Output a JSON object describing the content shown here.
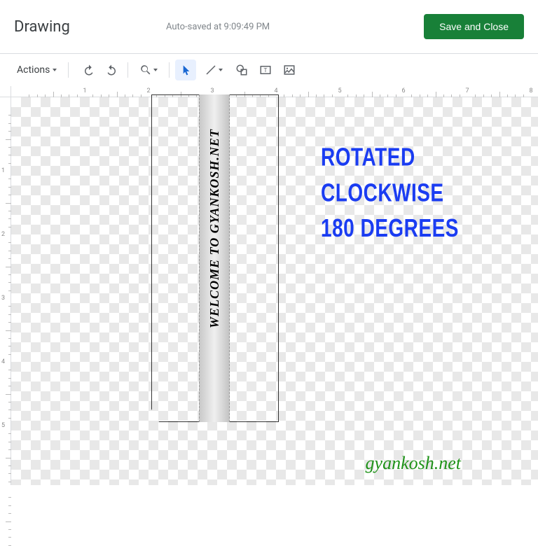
{
  "header": {
    "title": "Drawing",
    "autosave": "Auto-saved at 9:09:49 PM",
    "save_button": "Save and Close"
  },
  "toolbar": {
    "actions_label": "Actions"
  },
  "ruler": {
    "h": [
      "1",
      "2",
      "3",
      "4",
      "5",
      "6",
      "7",
      "8"
    ],
    "v": [
      "1",
      "2",
      "3",
      "4",
      "5"
    ]
  },
  "canvas": {
    "rotated_text": "WELCOME TO GYANKOSH.NET",
    "blue_label_line1": "ROTATED CLOCKWISE",
    "blue_label_line2": "180 DEGREES",
    "watermark": "gyankosh.net"
  }
}
